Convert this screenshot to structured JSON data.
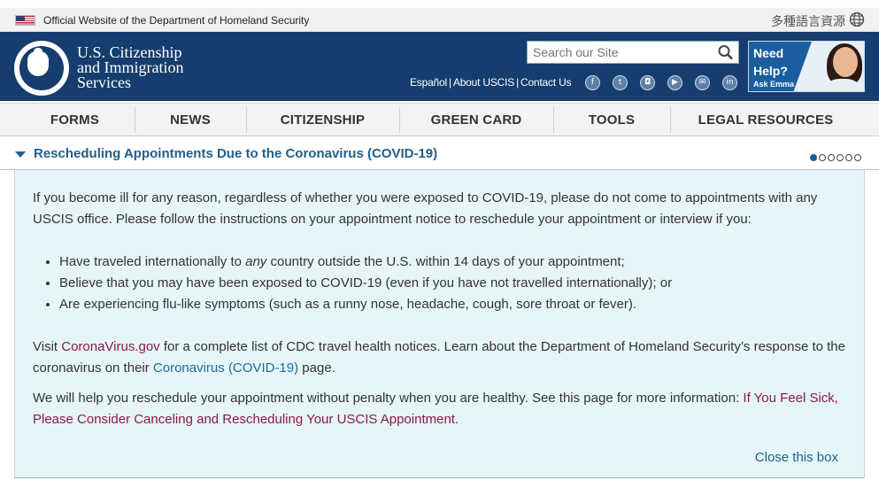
{
  "gov_banner": {
    "official_text": "Official Website of the Department of Homeland Security",
    "language_link": "多種語言資源"
  },
  "header": {
    "brand_line1": "U.S. Citizenship",
    "brand_line2": "and Immigration",
    "brand_line3": "Services",
    "search_placeholder": "Search our Site",
    "utility_links": [
      "Español",
      "About USCIS",
      "Contact Us"
    ],
    "emma": {
      "need": "Need",
      "help": "Help?",
      "ask": "Ask Emma"
    }
  },
  "nav": {
    "items": [
      "FORMS",
      "NEWS",
      "CITIZENSHIP",
      "GREEN CARD",
      "TOOLS",
      "LEGAL RESOURCES"
    ]
  },
  "alert": {
    "title": "Rescheduling Appointments Due to the Coronavirus (COVID-19)",
    "slide_count": 6,
    "active_slide": 1,
    "p1": "If you become ill for any reason, regardless of whether you were exposed to COVID-19, please do not come to appointments with any USCIS office. Please follow the instructions on your appointment notice to reschedule your appointment or interview if you:",
    "bullet1_before": "Have traveled internationally to ",
    "bullet1_em": "any",
    "bullet1_after": " country outside the U.S. within 14 days of your appointment;",
    "bullet2": "Believe that you may have been exposed to COVID-19 (even if you have not travelled internationally); or",
    "bullet3": "Are experiencing flu-like symptoms (such as a runny nose, headache, cough, sore throat or fever).",
    "p2_visit": "Visit ",
    "p2_link1": "CoronaVirus.gov",
    "p2_mid": " for a complete list of CDC travel health notices. Learn about the Department of Homeland Security’s response to the coronavirus on their ",
    "p2_link2": "Coronavirus (COVID-19)",
    "p2_end": " page.",
    "p3_text": "We will help you reschedule your appointment without penalty when you are healthy. See this page for more information: ",
    "p3_link": "If You Feel Sick, Please Consider Canceling and Rescheduling Your USCIS Appointment",
    "p3_end": ".",
    "close_label": "Close this box"
  },
  "colors": {
    "header_bg": "#153d6d",
    "alert_bg": "#e6f5f9",
    "link_blue": "#1f5f8b",
    "link_red": "#8b1a4a"
  }
}
